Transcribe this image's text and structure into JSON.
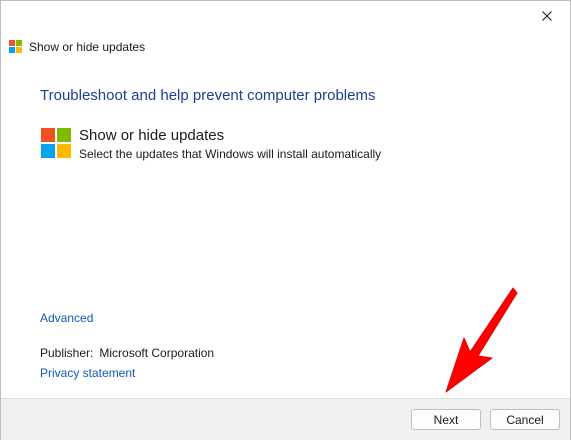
{
  "window": {
    "title": "Show or hide updates",
    "close_icon": "close-icon"
  },
  "main": {
    "heading": "Troubleshoot and help prevent computer problems",
    "tool_title": "Show or hide updates",
    "tool_description": "Select the updates that Windows will install automatically",
    "advanced_link": "Advanced",
    "publisher_label": "Publisher:",
    "publisher_value": "Microsoft Corporation",
    "privacy_link": "Privacy statement"
  },
  "footer": {
    "next_label": "Next",
    "cancel_label": "Cancel"
  },
  "colors": {
    "heading": "#1c3f94",
    "link": "#0b5cb8",
    "arrow": "#ff0000",
    "logo_red": "#f25022",
    "logo_green": "#7fba00",
    "logo_blue": "#00a4ef",
    "logo_yellow": "#ffb900"
  }
}
